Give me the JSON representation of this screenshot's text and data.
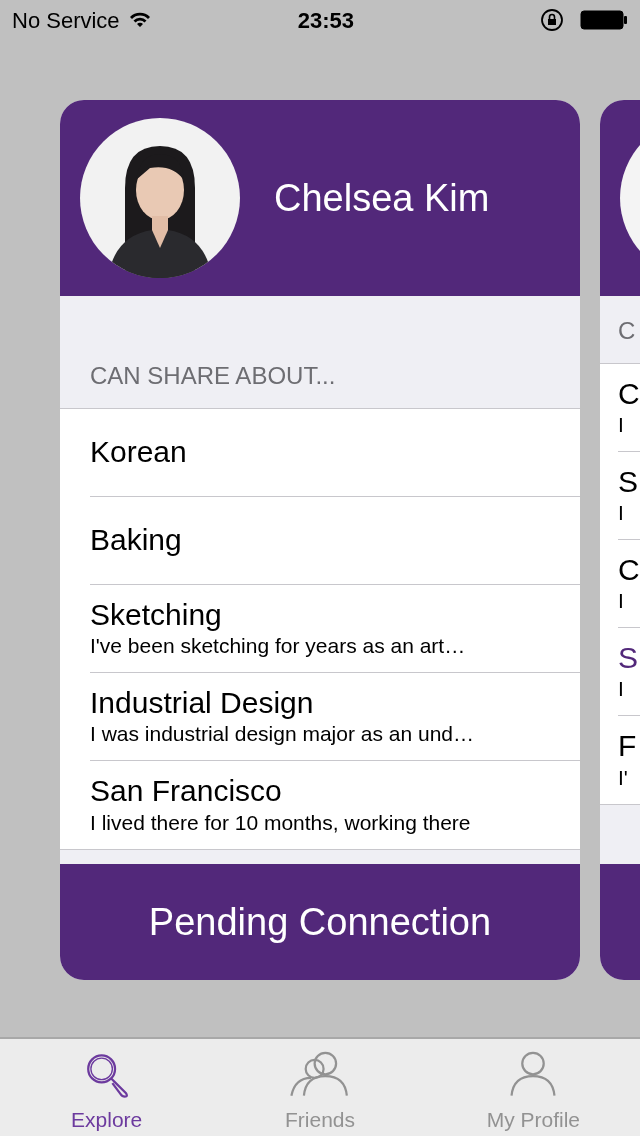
{
  "status_bar": {
    "carrier": "No Service",
    "time": "23:53"
  },
  "cards": [
    {
      "name": "Chelsea Kim",
      "section_header": "CAN SHARE ABOUT...",
      "action": "Pending Connection",
      "topics": [
        {
          "title": "Korean",
          "highlighted": false
        },
        {
          "title": "Baking",
          "highlighted": false
        },
        {
          "title": "Sketching",
          "subtitle": "I've been sketching for years as an art…",
          "highlighted": false
        },
        {
          "title": "Industrial Design",
          "subtitle": "I was industrial design major as an und…",
          "highlighted": false
        },
        {
          "title": "San Francisco",
          "subtitle": "I lived there for 10 months, working there",
          "highlighted": false
        }
      ]
    },
    {
      "section_header": "C",
      "topics": [
        {
          "title": "C",
          "subtitle": "I",
          "highlighted": false
        },
        {
          "title": "S",
          "subtitle": "I",
          "highlighted": false
        },
        {
          "title": "C",
          "subtitle": "I",
          "highlighted": false
        },
        {
          "title": "S",
          "subtitle": "I",
          "highlighted": true
        },
        {
          "title": "F",
          "subtitle": "I'",
          "highlighted": false
        }
      ]
    }
  ],
  "tabs": [
    {
      "label": "Explore",
      "kind": "search",
      "selected": true
    },
    {
      "label": "Friends",
      "kind": "friends",
      "selected": false
    },
    {
      "label": "My Profile",
      "kind": "profile",
      "selected": false
    }
  ]
}
